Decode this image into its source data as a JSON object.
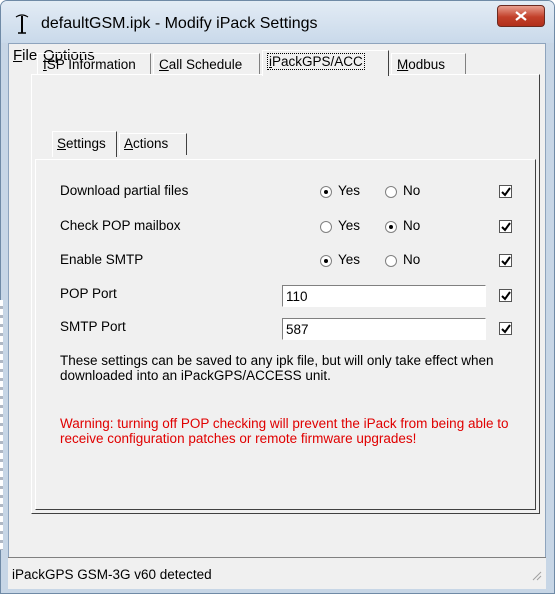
{
  "window": {
    "title": "defaultGSM.ipk - Modify iPack Settings"
  },
  "menu": {
    "file": "File",
    "options": "Options"
  },
  "tabs": [
    {
      "label": "ISP Information"
    },
    {
      "label": "Call Schedule"
    },
    {
      "label": "iPackGPS/ACC"
    },
    {
      "label": "Modbus"
    }
  ],
  "subtabs": [
    {
      "label": "Settings"
    },
    {
      "label": "Actions"
    }
  ],
  "settings": {
    "download_partial": {
      "label": "Download partial files",
      "yes": "Yes",
      "no": "No",
      "selected": "Yes",
      "checked": true
    },
    "check_pop": {
      "label": "Check POP mailbox",
      "yes": "Yes",
      "no": "No",
      "selected": "No",
      "checked": true
    },
    "enable_smtp": {
      "label": "Enable SMTP",
      "yes": "Yes",
      "no": "No",
      "selected": "Yes",
      "checked": true
    },
    "pop_port": {
      "label": "POP Port",
      "value": "110",
      "checked": true
    },
    "smtp_port": {
      "label": "SMTP Port",
      "value": "587",
      "checked": true
    }
  },
  "info_text": "These settings can be saved to any ipk file, but will only take effect when downloaded into an iPackGPS/ACCESS unit.",
  "warning_text": "Warning: turning off POP checking will prevent the iPack from being able to receive configuration patches or remote firmware upgrades!",
  "status": "iPackGPS GSM-3G v60 detected",
  "colors": {
    "warning": "#e00000",
    "window_frame": "#c7d6e6",
    "close_button": "#c2402a"
  }
}
